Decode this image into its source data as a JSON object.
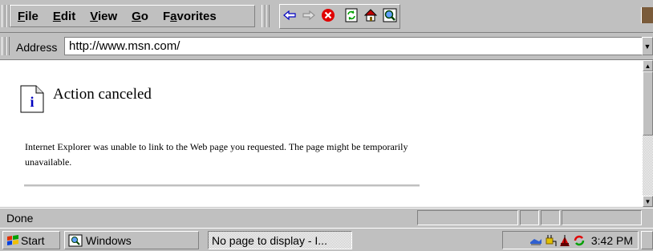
{
  "menu": {
    "items": [
      {
        "label": "File",
        "accel": "F",
        "rest": "ile"
      },
      {
        "label": "Edit",
        "accel": "E",
        "rest": "dit"
      },
      {
        "label": "View",
        "accel": "V",
        "rest": "iew"
      },
      {
        "label": "Go",
        "accel": "G",
        "rest": "o"
      },
      {
        "label": "Favorites",
        "pre": "F",
        "accel": "a",
        "rest": "vorites"
      }
    ]
  },
  "toolbar": {
    "buttons": [
      "back-icon",
      "forward-icon",
      "stop-icon",
      "refresh-icon",
      "home-icon",
      "search-icon"
    ]
  },
  "address": {
    "label": "Address",
    "value": "http://www.msn.com/"
  },
  "page": {
    "title": "Action canceled",
    "message": "Internet Explorer was unable to link to the Web page you requested. The page might be temporarily unavailable."
  },
  "status": {
    "text": "Done"
  },
  "taskbar": {
    "start_label": "Start",
    "windows_label": "Windows",
    "active_task_label": "No page to display - I...",
    "clock": "3:42 PM",
    "tray_icons": [
      "network-icon",
      "power-plug-icon",
      "signal-icon",
      "sync-icon"
    ]
  },
  "colors": {
    "chrome": "#c0c0c0",
    "content_bg": "#ffffff",
    "stop_red": "#e00000",
    "nav_blue": "#0000c0"
  }
}
